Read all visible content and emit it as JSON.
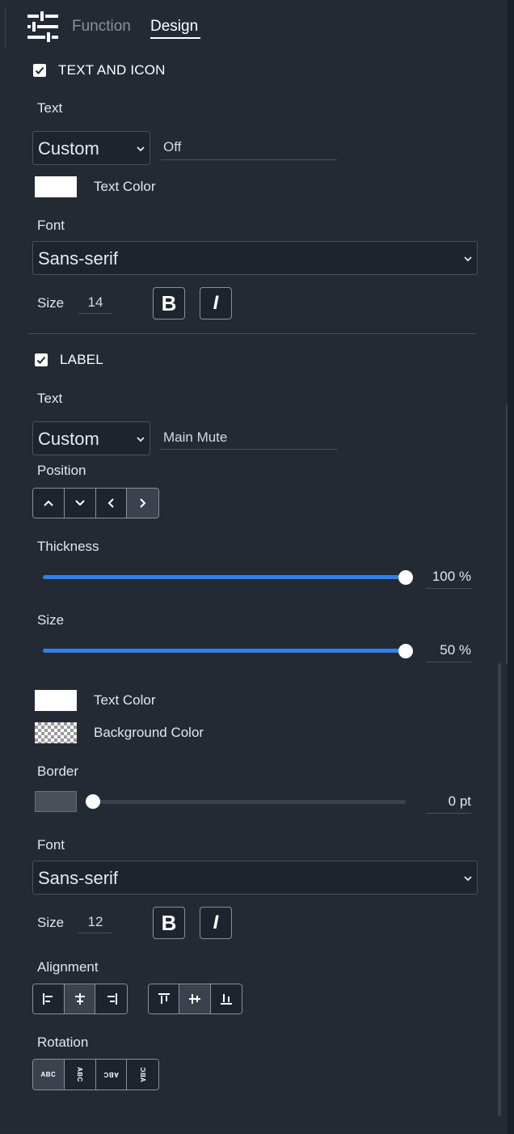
{
  "tabs": {
    "function_label": "Function",
    "design_label": "Design"
  },
  "text_and_icon": {
    "title": "TEXT AND ICON",
    "checked": true,
    "text_label": "Text",
    "text_mode": "Custom",
    "text_value": "Off",
    "text_color_label": "Text Color",
    "text_color": "#ffffff",
    "font_label": "Font",
    "font_value": "Sans-serif",
    "size_label": "Size",
    "size_value": "14",
    "bold_label": "B",
    "italic_label": "I"
  },
  "label": {
    "title": "LABEL",
    "checked": true,
    "text_label": "Text",
    "text_mode": "Custom",
    "text_value": "Main Mute",
    "position_label": "Position",
    "position_active": "right",
    "thickness_label": "Thickness",
    "thickness_value": 100,
    "thickness_text": "100 %",
    "size_slider_label": "Size",
    "size_slider_value": 100,
    "size_slider_text": "50 %",
    "text_color_label": "Text Color",
    "text_color": "#ffffff",
    "background_color_label": "Background Color",
    "background_color": "transparent",
    "border_label": "Border",
    "border_value": 0,
    "border_text": "0 pt",
    "font_label": "Font",
    "font_value": "Sans-serif",
    "size_label": "Size",
    "size_value": "12",
    "bold_label": "B",
    "italic_label": "I",
    "alignment_label": "Alignment",
    "h_align_active": "center",
    "v_align_active": "middle",
    "rotation_label": "Rotation",
    "rotation_active": "0",
    "rotation_text": "ABC"
  },
  "colors": {
    "background": "#232a34",
    "accent": "#2f80ed",
    "border": "#8a9099"
  }
}
